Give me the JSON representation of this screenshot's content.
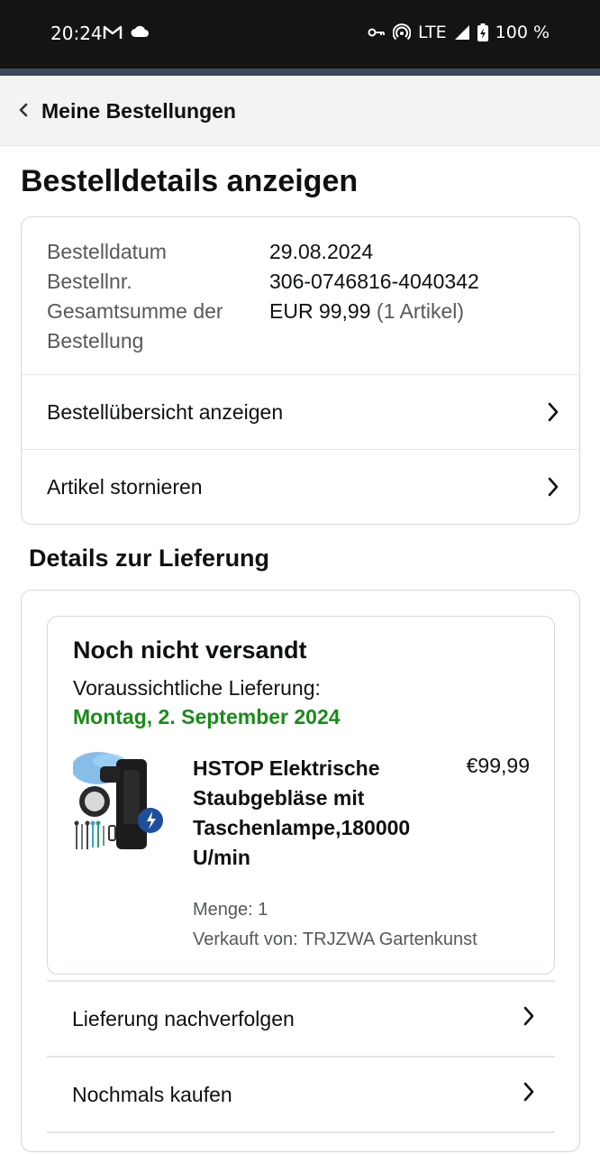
{
  "status_bar": {
    "time": "20:24",
    "network": "LTE",
    "battery": "100 %"
  },
  "nav": {
    "back_label": "Meine Bestellungen"
  },
  "page": {
    "title": "Bestelldetails anzeigen"
  },
  "order": {
    "date_label": "Bestelldatum",
    "date_value": "29.08.2024",
    "number_label": "Bestellnr.",
    "number_value": "306-0746816-4040342",
    "total_label": "Gesamtsumme der Bestellung",
    "total_value": "EUR 99,99",
    "total_items": "(1 Artikel)",
    "summary_link": "Bestellübersicht anzeigen",
    "cancel_link": "Artikel stornieren"
  },
  "delivery": {
    "section_title": "Details zur Lieferung",
    "status": "Noch nicht versandt",
    "eta_label": "Voraussichtliche Lieferung:",
    "eta_date": "Montag, 2. September 2024",
    "eta_color": "#1a8a1a",
    "product": {
      "name": "HSTOP Elektrische Staubgebläse mit Taschenlampe,180000 U/min",
      "price": "€99,99",
      "quantity": "Menge: 1",
      "seller": "Verkauft von: TRJZWA Gartenkunst",
      "image_icon": "air-blower-product-image"
    },
    "track_link": "Lieferung nachverfolgen",
    "buy_again_link": "Nochmals kaufen"
  }
}
